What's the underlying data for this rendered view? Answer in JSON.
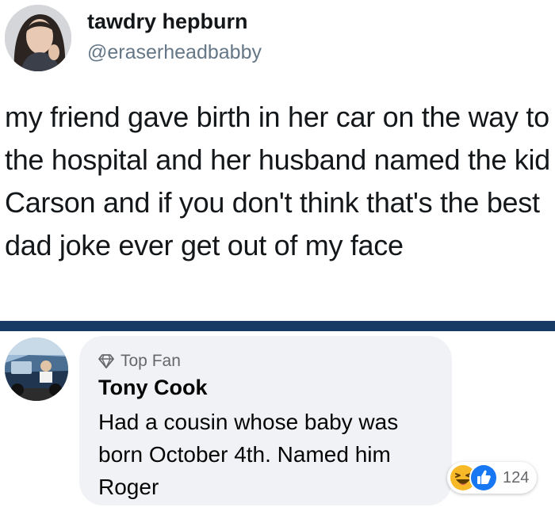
{
  "tweet": {
    "display_name": "tawdry hepburn",
    "handle": "@eraserheadbabby",
    "text": "my friend gave birth in her car on the way to the hospital and her husband named the kid Carson and if you don't think that's the best dad joke ever get out of my face",
    "avatar_icon": "profile-photo"
  },
  "comment": {
    "badge_icon": "diamond-icon",
    "badge_label": "Top Fan",
    "author": "Tony Cook",
    "text": "Had a cousin whose baby was born October 4th. Named him Roger",
    "avatar_icon": "profile-photo",
    "reactions": {
      "icons": [
        "haha-icon",
        "like-icon"
      ],
      "count": "124"
    }
  },
  "colors": {
    "divider": "#183b66",
    "bubble": "#f0f2f5",
    "like_blue": "#1877f2",
    "haha_yellow": "#f7b928",
    "handle_gray": "#657786"
  }
}
